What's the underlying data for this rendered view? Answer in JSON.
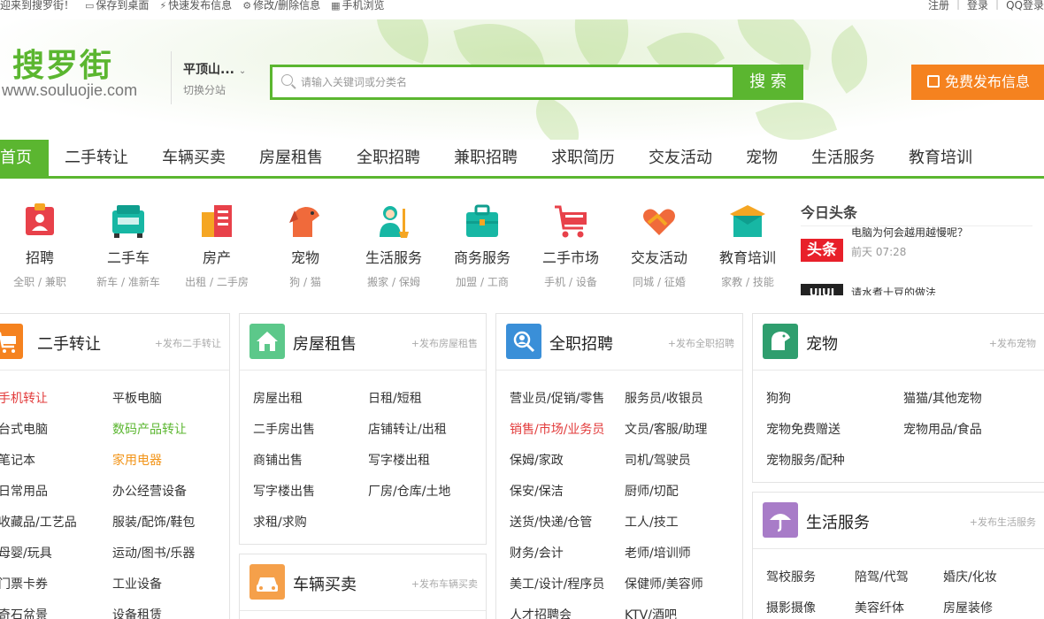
{
  "topbar": {
    "welcome": "迎来到搜罗街！",
    "save_desktop": "保存到桌面",
    "quick_publish": "快速发布信息",
    "edit_delete": "修改/删除信息",
    "mobile": "手机浏览",
    "register": "注册",
    "login": "登录",
    "qq_login": "QQ登录"
  },
  "header": {
    "logo_cn": "搜罗街",
    "logo_en": "www.souluojie.com",
    "city": "平顶山...",
    "switch_city": "切换分站",
    "search_placeholder": "请输入关键词或分类名",
    "search_button": "搜 索",
    "publish_button": "免费发布信息"
  },
  "nav": [
    "首页",
    "二手转让",
    "车辆买卖",
    "房屋租售",
    "全职招聘",
    "兼职招聘",
    "求职简历",
    "交友活动",
    "宠物",
    "生活服务",
    "教育培训"
  ],
  "icon_categories": [
    {
      "name": "招聘",
      "sub": "全职 / 兼职"
    },
    {
      "name": "二手车",
      "sub": "新车 / 准新车"
    },
    {
      "name": "房产",
      "sub": "出租 / 二手房"
    },
    {
      "name": "宠物",
      "sub": "狗 / 猫"
    },
    {
      "name": "生活服务",
      "sub": "搬家 / 保姆"
    },
    {
      "name": "商务服务",
      "sub": "加盟 / 工商"
    },
    {
      "name": "二手市场",
      "sub": "手机 / 设备"
    },
    {
      "name": "交友活动",
      "sub": "同城 / 征婚"
    },
    {
      "name": "教育培训",
      "sub": "家教 / 技能"
    }
  ],
  "headlines": {
    "title": "今日头条",
    "items": [
      {
        "tag": "头条",
        "text": "电脑为何会越用越慢呢？",
        "time": "前天 07:28"
      },
      {
        "tag": "UIUI",
        "text": "请水煮十豆的做法"
      }
    ]
  },
  "panels": {
    "second_hand": {
      "title": "二手转让",
      "link": "+发布二手转让",
      "items": [
        "手机转让",
        "平板电脑",
        "台式电脑",
        "数码产品转让",
        "笔记本",
        "家用电器",
        "日常用品",
        "办公经营设备",
        "收藏品/工艺品",
        "服装/配饰/鞋包",
        "母婴/玩具",
        "运动/图书/乐器",
        "门票卡券",
        "工业设备",
        "奇石盆景",
        "设备租赁"
      ]
    },
    "house": {
      "title": "房屋租售",
      "link": "+发布房屋租售",
      "items": [
        "房屋出租",
        "日租/短租",
        "二手房出售",
        "店铺转让/出租",
        "商铺出售",
        "写字楼出租",
        "写字楼出售",
        "厂房/仓库/土地",
        "求租/求购"
      ]
    },
    "vehicle": {
      "title": "车辆买卖",
      "link": "+发布车辆买卖"
    },
    "jobs": {
      "title": "全职招聘",
      "link": "+发布全职招聘",
      "items": [
        "营业员/促销/零售",
        "服务员/收银员",
        "销售/市场/业务员",
        "文员/客服/助理",
        "保姆/家政",
        "司机/驾驶员",
        "保安/保洁",
        "厨师/切配",
        "送货/快递/仓管",
        "工人/技工",
        "财务/会计",
        "老师/培训师",
        "美工/设计/程序员",
        "保健师/美容师",
        "人才招聘会",
        "KTV/酒吧"
      ]
    },
    "pets": {
      "title": "宠物",
      "link": "+发布宠物",
      "items": [
        "狗狗",
        "猫猫/其他宠物",
        "宠物免费赠送",
        "宠物用品/食品",
        "宠物服务/配种"
      ]
    },
    "life": {
      "title": "生活服务",
      "link": "+发布生活服务",
      "items": [
        "驾校服务",
        "陪驾/代驾",
        "婚庆/化妆",
        "摄影摄像",
        "美容纤体",
        "房屋装修"
      ]
    }
  },
  "colors": {
    "brand_green": "#5bb630",
    "orange": "#f5821f",
    "red": "#e23b3b"
  }
}
